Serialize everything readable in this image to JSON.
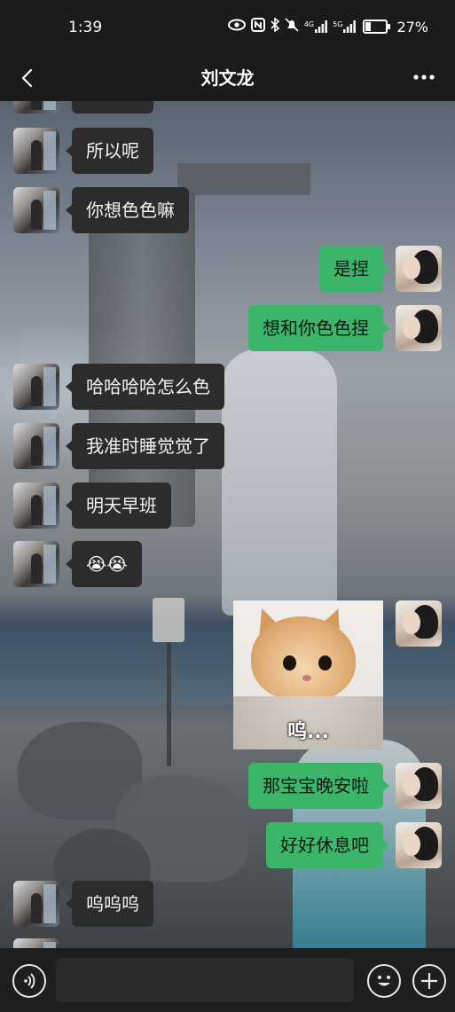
{
  "status_bar": {
    "time": "1:39",
    "network_label_1": "4G",
    "network_label_2": "5G",
    "battery_percent": "27%",
    "battery_level": 0.27,
    "icons": [
      "eye-icon",
      "nfc-icon",
      "bluetooth-icon",
      "mute-icon",
      "signal-icon",
      "signal-icon",
      "battery-icon"
    ]
  },
  "header": {
    "title": "刘文龙",
    "back_icon": "chevron-left-icon",
    "more_icon": "more-dots-icon"
  },
  "messages": [
    {
      "sender": "other",
      "type": "text",
      "text": "所以呢"
    },
    {
      "sender": "other",
      "type": "text",
      "text": "你想色色嘛"
    },
    {
      "sender": "self",
      "type": "text",
      "text": "是捏"
    },
    {
      "sender": "self",
      "type": "text",
      "text": "想和你色色捏"
    },
    {
      "sender": "other",
      "type": "text",
      "text": "哈哈哈哈怎么色"
    },
    {
      "sender": "other",
      "type": "text",
      "text": "我准时睡觉觉了"
    },
    {
      "sender": "other",
      "type": "text",
      "text": "明天早班"
    },
    {
      "sender": "other",
      "type": "text",
      "text": "😭😭"
    },
    {
      "sender": "self",
      "type": "sticker",
      "caption": "呜..."
    },
    {
      "sender": "self",
      "type": "text",
      "text": "那宝宝晚安啦"
    },
    {
      "sender": "self",
      "type": "text",
      "text": "好好休息吧"
    },
    {
      "sender": "other",
      "type": "text",
      "text": "呜呜呜"
    }
  ],
  "input_bar": {
    "voice_icon": "voice-icon",
    "input_value": "",
    "emoji_icon": "emoji-icon",
    "plus_icon": "plus-icon"
  },
  "colors": {
    "self_bubble": "#3bb56a",
    "other_bubble": "#2c2c2c",
    "bar_background": "#1b1b1b"
  }
}
